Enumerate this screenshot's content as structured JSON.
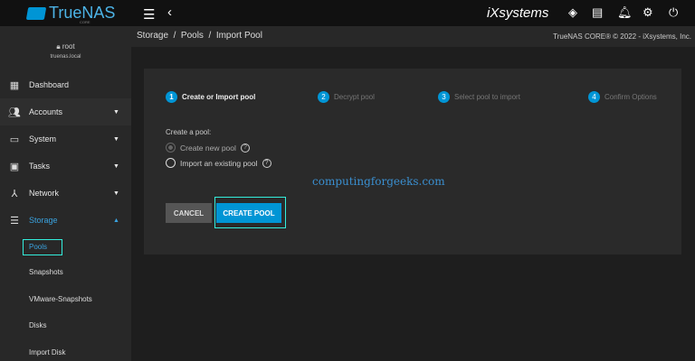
{
  "header": {
    "brand": "TrueNAS",
    "brand_sub": "CORE",
    "vendor": "iXsystems"
  },
  "user": {
    "name": "root",
    "host": "truenas.local"
  },
  "sidebar": {
    "items": [
      {
        "label": "Dashboard"
      },
      {
        "label": "Accounts"
      },
      {
        "label": "System"
      },
      {
        "label": "Tasks"
      },
      {
        "label": "Network"
      },
      {
        "label": "Storage"
      }
    ],
    "storage_sub": [
      "Pools",
      "Snapshots",
      "VMware-Snapshots",
      "Disks",
      "Import Disk"
    ]
  },
  "breadcrumb": {
    "text": "Storage  /  Pools  /  Import Pool",
    "copyright": "TrueNAS CORE® © 2022 - iXsystems, Inc."
  },
  "steps": [
    {
      "n": "1",
      "label": "Create or Import pool"
    },
    {
      "n": "2",
      "label": "Decrypt pool"
    },
    {
      "n": "3",
      "label": "Select pool to import"
    },
    {
      "n": "4",
      "label": "Confirm Options"
    }
  ],
  "form": {
    "label": "Create a pool:",
    "opt1": "Create new pool",
    "opt2": "Import an existing pool",
    "cancel": "CANCEL",
    "create": "CREATE POOL",
    "help": "?"
  },
  "watermark": "computingforgeeks.com"
}
